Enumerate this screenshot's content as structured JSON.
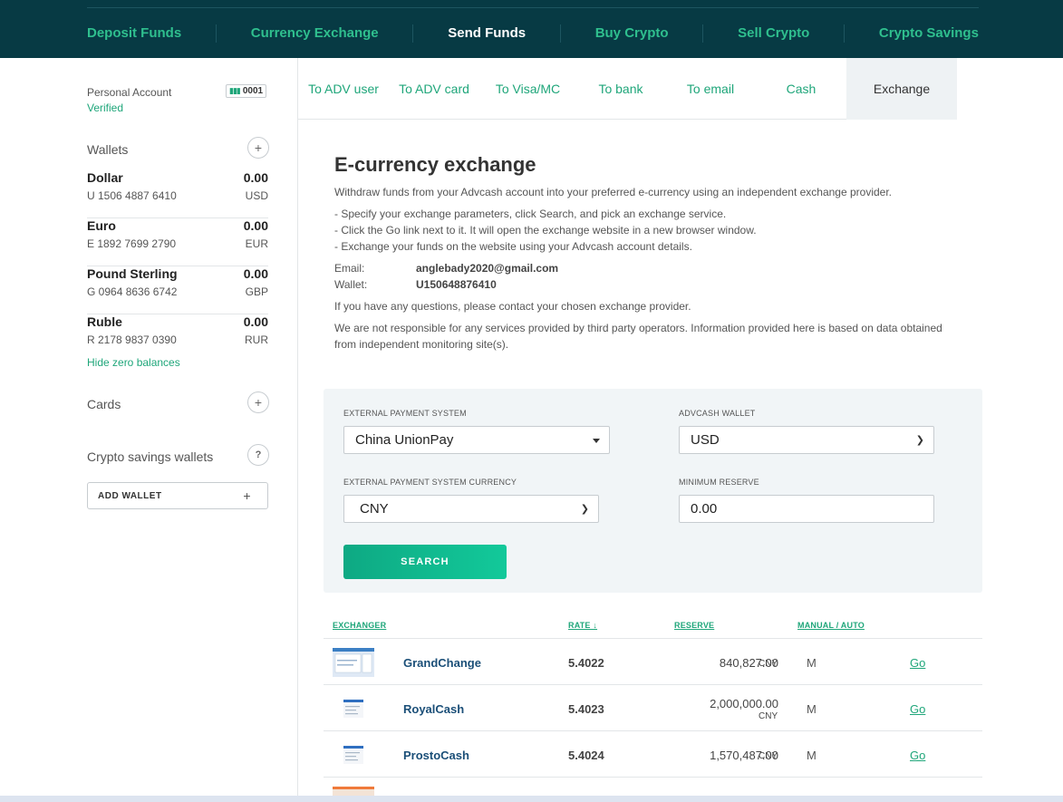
{
  "topnav": {
    "items": [
      {
        "label": "Deposit Funds",
        "active": false
      },
      {
        "label": "Currency Exchange",
        "active": false
      },
      {
        "label": "Send Funds",
        "active": true
      },
      {
        "label": "Buy Crypto",
        "active": false
      },
      {
        "label": "Sell Crypto",
        "active": false
      },
      {
        "label": "Crypto Savings",
        "active": false
      }
    ]
  },
  "account": {
    "label": "Personal Account",
    "status": "Verified",
    "badge": "0001"
  },
  "wallets": {
    "title": "Wallets",
    "items": [
      {
        "name": "Dollar",
        "balance": "0.00",
        "number": "U 1506 4887 6410",
        "currency": "USD"
      },
      {
        "name": "Euro",
        "balance": "0.00",
        "number": "E 1892 7699 2790",
        "currency": "EUR"
      },
      {
        "name": "Pound Sterling",
        "balance": "0.00",
        "number": "G 0964 8636 6742",
        "currency": "GBP"
      },
      {
        "name": "Ruble",
        "balance": "0.00",
        "number": "R 2178 9837 0390",
        "currency": "RUR"
      }
    ],
    "hide_zero": "Hide zero balances"
  },
  "cards": {
    "title": "Cards"
  },
  "crypto_savings": {
    "title": "Crypto savings wallets",
    "add_wallet": "ADD WALLET"
  },
  "subtabs": [
    {
      "label": "To ADV user",
      "active": false
    },
    {
      "label": "To ADV card",
      "active": false
    },
    {
      "label": "To Visa/MC",
      "active": false
    },
    {
      "label": "To bank",
      "active": false
    },
    {
      "label": "To email",
      "active": false
    },
    {
      "label": "Cash",
      "active": false
    },
    {
      "label": "Exchange",
      "active": true
    }
  ],
  "main": {
    "title": "E-currency exchange",
    "intro": "Withdraw funds from your Advcash account into your preferred e-currency using an independent exchange provider.",
    "steps": [
      "- Specify your exchange parameters, click Search, and pick an exchange service.",
      "- Click the Go link next to it. It will open the exchange website in a new browser window.",
      "- Exchange your funds on the website using your Advcash account details."
    ],
    "email_label": "Email:",
    "email_value": "anglebady2020@gmail.com",
    "wallet_label": "Wallet:",
    "wallet_value": "U150648876410",
    "questions": "If you have any questions, please contact your chosen exchange provider.",
    "disclaimer": "We are not responsible for any services provided by third party operators. Information provided here is based on data obtained from independent monitoring site(s)."
  },
  "form": {
    "eps_label": "EXTERNAL PAYMENT SYSTEM",
    "eps_value": "China UnionPay",
    "wallet_label": "ADVCASH WALLET",
    "wallet_value": "USD",
    "eps_currency_label": "EXTERNAL PAYMENT SYSTEM CURRENCY",
    "eps_currency_value": "CNY",
    "min_reserve_label": "MINIMUM RESERVE",
    "min_reserve_value": "0.00",
    "search": "SEARCH"
  },
  "table": {
    "headers": {
      "exchanger": "EXCHANGER",
      "rate": "RATE ↓",
      "reserve": "RESERVE",
      "mode": "MANUAL / AUTO"
    },
    "rows": [
      {
        "name": "GrandChange",
        "rate": "5.4022",
        "reserve": "840,827.00",
        "currency": "CNY",
        "mode": "M",
        "go": "Go"
      },
      {
        "name": "RoyalCash",
        "rate": "5.4023",
        "reserve": "2,000,000.00",
        "currency": "CNY",
        "mode": "M",
        "go": "Go"
      },
      {
        "name": "ProstoCash",
        "rate": "5.4024",
        "reserve": "1,570,487.00",
        "currency": "CNY",
        "mode": "M",
        "go": "Go"
      }
    ]
  },
  "colors": {
    "nav_bg": "#073a44",
    "accent_green": "#1fa67a",
    "link_blue": "#1b4f78",
    "form_bg": "#f1f5f7"
  }
}
